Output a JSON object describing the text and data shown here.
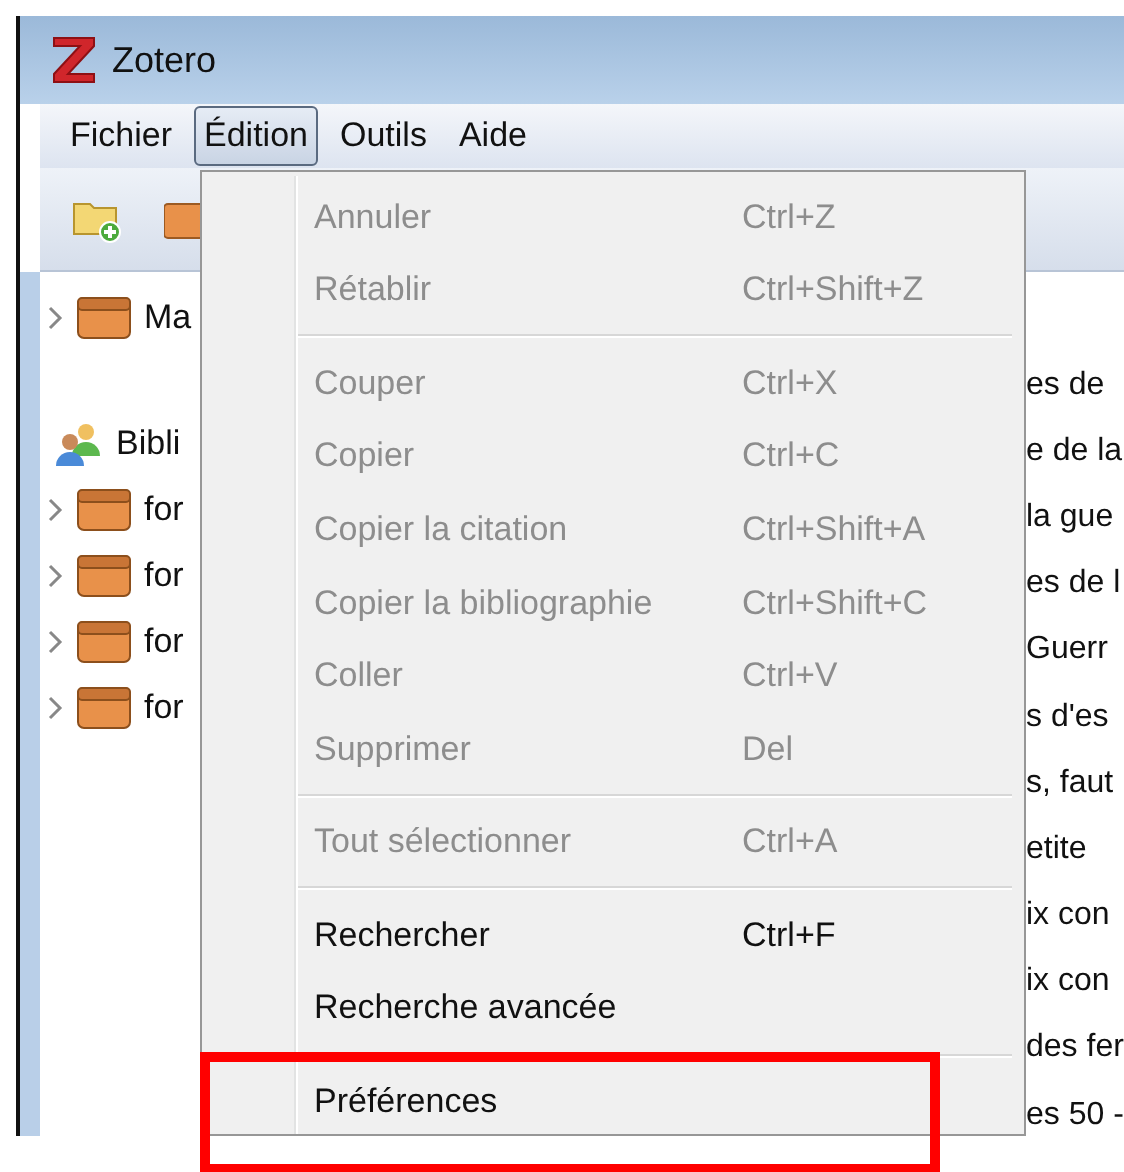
{
  "window": {
    "title": "Zotero"
  },
  "menubar": [
    {
      "label": "Fichier",
      "selected": false
    },
    {
      "label": "Édition",
      "selected": true
    },
    {
      "label": "Outils",
      "selected": false
    },
    {
      "label": "Aide",
      "selected": false
    }
  ],
  "collections": [
    {
      "label": "Ma",
      "kind": "box"
    },
    {
      "label": "Bibli",
      "kind": "group"
    },
    {
      "label": "for",
      "kind": "box"
    },
    {
      "label": "for",
      "kind": "box"
    },
    {
      "label": "for",
      "kind": "box"
    },
    {
      "label": "for",
      "kind": "box"
    }
  ],
  "items": [
    "es de",
    "e de la",
    "la gue",
    "es de l",
    "Guerr",
    "s d'es",
    "s, faut",
    "etite",
    "ix con",
    "ix con",
    "des fer",
    "es 50 -"
  ],
  "menu": [
    {
      "kind": "item",
      "label": "Annuler",
      "shortcut": "Ctrl+Z",
      "disabled": true,
      "highlighted": false
    },
    {
      "kind": "item",
      "label": "Rétablir",
      "shortcut": "Ctrl+Shift+Z",
      "disabled": true,
      "highlighted": false
    },
    {
      "kind": "separator"
    },
    {
      "kind": "item",
      "label": "Couper",
      "shortcut": "Ctrl+X",
      "disabled": true,
      "highlighted": false
    },
    {
      "kind": "item",
      "label": "Copier",
      "shortcut": "Ctrl+C",
      "disabled": true,
      "highlighted": false
    },
    {
      "kind": "item",
      "label": "Copier la citation",
      "shortcut": "Ctrl+Shift+A",
      "disabled": true,
      "highlighted": false
    },
    {
      "kind": "item",
      "label": "Copier la bibliographie",
      "shortcut": "Ctrl+Shift+C",
      "disabled": true,
      "highlighted": false
    },
    {
      "kind": "item",
      "label": "Coller",
      "shortcut": "Ctrl+V",
      "disabled": true,
      "highlighted": false
    },
    {
      "kind": "item",
      "label": "Supprimer",
      "shortcut": "Del",
      "disabled": true,
      "highlighted": false
    },
    {
      "kind": "separator"
    },
    {
      "kind": "item",
      "label": "Tout sélectionner",
      "shortcut": "Ctrl+A",
      "disabled": true,
      "highlighted": false
    },
    {
      "kind": "separator"
    },
    {
      "kind": "item",
      "label": "Rechercher",
      "shortcut": "Ctrl+F",
      "disabled": false,
      "highlighted": false
    },
    {
      "kind": "item",
      "label": "Recherche avancée",
      "disabled": false,
      "highlighted": false
    },
    {
      "kind": "separator"
    },
    {
      "kind": "item",
      "label": "Préférences",
      "disabled": false,
      "highlighted": true
    }
  ]
}
